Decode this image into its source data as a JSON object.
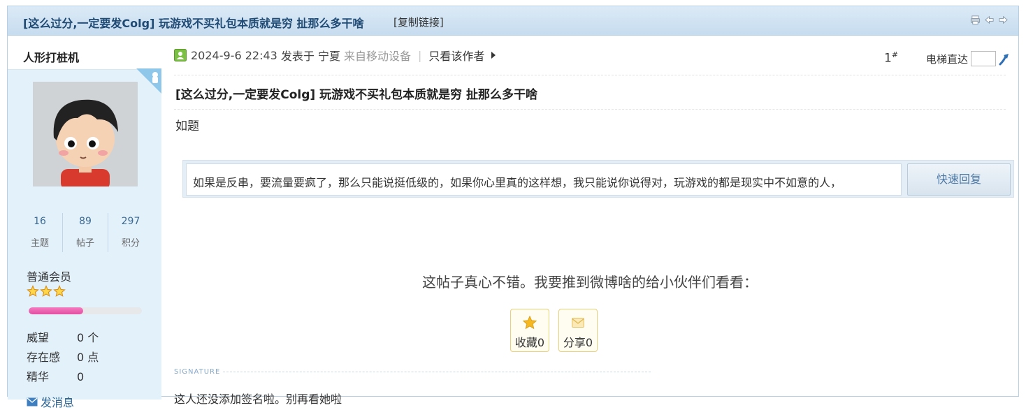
{
  "header": {
    "thread_title": "[这么过分,一定要发Colg] 玩游戏不买礼包本质就是穷 扯那么多干啥",
    "copy_link": "[复制链接]",
    "tools": [
      "print-icon",
      "previous-thread-icon",
      "next-thread-icon"
    ]
  },
  "author": {
    "name": "人形打桩机",
    "stats": [
      {
        "value": "16",
        "label": "主题"
      },
      {
        "value": "89",
        "label": "帖子"
      },
      {
        "value": "297",
        "label": "积分"
      }
    ],
    "group": "普通会员",
    "star_count": 3,
    "level_progress": 0.48,
    "attributes": [
      {
        "label": "威望",
        "value": "0 个"
      },
      {
        "label": "存在感",
        "value": "0 点"
      },
      {
        "label": "精华",
        "value": "0"
      }
    ],
    "pm_link": "发消息"
  },
  "post": {
    "date": "2024-9-6 22:43",
    "posted_in": "发表于 宁夏",
    "from_device": "来自移动设备",
    "separator": "|",
    "only_author": "只看该作者",
    "floor_number": "1",
    "floor_suffix": "#",
    "jump_label": "电梯直达",
    "title": "[这么过分,一定要发Colg] 玩游戏不买礼包本质就是穷 扯那么多干啥",
    "body": "如题"
  },
  "quick_reply": {
    "text": "如果是反串，要流量要疯了，那么只能说挺低级的，如果你心里真的这样想，我只能说你说得对，玩游戏的都是现实中不如意的人，",
    "button": "快速回复"
  },
  "share": {
    "prompt": "这帖子真心不错。我要推到微博啥的给小伙伴们看看：",
    "favorite_label": "收藏0",
    "share_label": "分享0"
  },
  "signature": {
    "label": "SIGNATURE",
    "text": "这人还没添加签名啦。别再看她啦"
  },
  "colors": {
    "title": "#1f4a74",
    "sidebar_bg": "#e3f1fb",
    "level_bar": "#e24fa1",
    "accent_link": "#2a6496"
  }
}
